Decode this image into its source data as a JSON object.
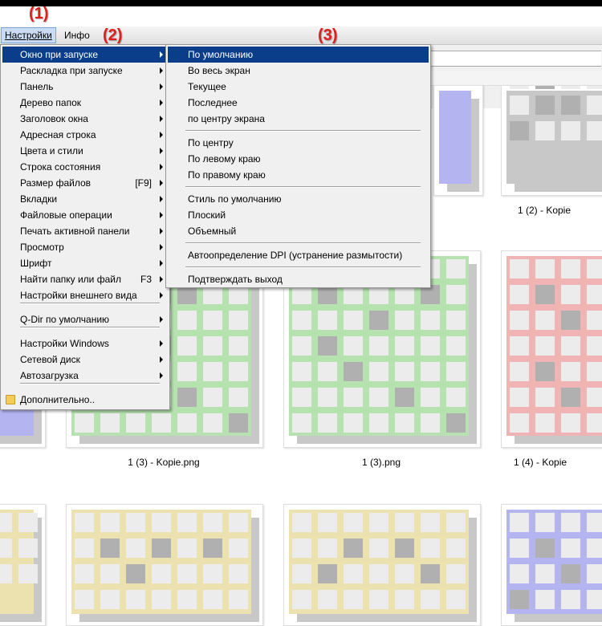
{
  "annotations": [
    "(1)",
    "(2)",
    "(3)"
  ],
  "menubar": {
    "settings": "Настройки",
    "info": "Инфо"
  },
  "settings_menu": {
    "items": [
      {
        "label": "Окно при запуске",
        "shortcut": "",
        "submenu": true
      },
      {
        "label": "Раскладка при запуске",
        "shortcut": "",
        "submenu": true
      },
      {
        "label": "Панель",
        "shortcut": "",
        "submenu": true
      },
      {
        "label": "Дерево папок",
        "shortcut": "",
        "submenu": true
      },
      {
        "label": "Заголовок окна",
        "shortcut": "",
        "submenu": true
      },
      {
        "label": "Адресная строка",
        "shortcut": "",
        "submenu": true
      },
      {
        "label": "Цвета и стили",
        "shortcut": "",
        "submenu": true
      },
      {
        "label": "Строка состояния",
        "shortcut": "",
        "submenu": true
      },
      {
        "label": "Размер файлов",
        "shortcut": "[F9]",
        "submenu": true
      },
      {
        "label": "Вкладки",
        "shortcut": "",
        "submenu": true
      },
      {
        "label": "Файловые операции",
        "shortcut": "",
        "submenu": true
      },
      {
        "label": "Печать активной панели",
        "shortcut": "",
        "submenu": true
      },
      {
        "label": "Просмотр",
        "shortcut": "",
        "submenu": true
      },
      {
        "label": "Шрифт",
        "shortcut": "",
        "submenu": true
      },
      {
        "label": "Найти папку или файл",
        "shortcut": "F3",
        "submenu": true
      },
      {
        "label": "Настройки внешнего вида",
        "shortcut": "",
        "submenu": true
      },
      {
        "label": "Q-Dir по умолчанию",
        "shortcut": "",
        "submenu": true
      },
      {
        "label": "Настройки Windows",
        "shortcut": "",
        "submenu": true
      },
      {
        "label": "Сетевой диск",
        "shortcut": "",
        "submenu": true
      },
      {
        "label": "Автозагрузка",
        "shortcut": "",
        "submenu": true
      },
      {
        "label": "Дополнительно..",
        "shortcut": "",
        "submenu": false,
        "icon": "folder-icon"
      }
    ]
  },
  "startup_submenu": {
    "items": [
      "По умолчанию",
      "Во весь экран",
      "Текущее",
      "Последнее",
      "по центру экрана",
      "По центру",
      "По левому краю",
      "По правому краю",
      "Стиль по умолчанию",
      "Плоский",
      "Объемный",
      "Автоопределение DPI (устранение размытости)",
      "Подтверждать выход"
    ]
  },
  "files": [
    {
      "caption": "1 (2) - Kopie",
      "color": "#c8c8c8"
    },
    {
      "caption": "1 (3) - Kopie.png",
      "color": "#b6e2b0"
    },
    {
      "caption": "1 (3).png",
      "color": "#b6e2b0"
    },
    {
      "caption": "1 (4) - Kopie",
      "color": "#f0b4b4"
    }
  ],
  "colors": {
    "menu_highlight": "#0a3d8a",
    "annotation": "#e01e1e",
    "purple": "#b4b4f0",
    "yellow": "#ece2b0",
    "grid_dark": "#b0b0b0",
    "grid_light": "#ececec"
  }
}
